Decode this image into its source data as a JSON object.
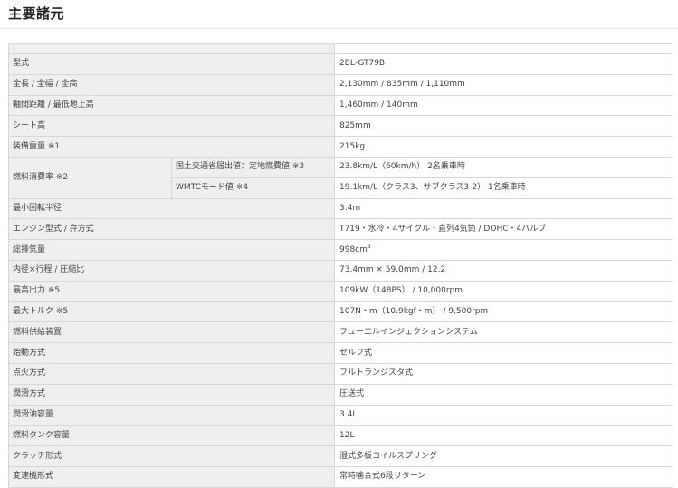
{
  "heading": "主要諸元",
  "rows": [
    {
      "label": "型式",
      "value": "2BL-GT79B"
    },
    {
      "label": "全長 / 全幅 / 全高",
      "value": "2,130mm / 835mm / 1,110mm"
    },
    {
      "label": "軸間距離 / 最低地上高",
      "value": "1,460mm / 140mm"
    },
    {
      "label": "シート高",
      "value": "825mm"
    },
    {
      "label": "装備重量 ※1",
      "value": "215kg"
    },
    {
      "label": "燃料消費率 ※2",
      "sub_rows": [
        {
          "label": "国土交通省届出値：定地燃費値 ※3",
          "value": "23.8km/L（60km/h） 2名乗車時"
        },
        {
          "label": "WMTCモード値 ※4",
          "value": "19.1km/L（クラス3、サブクラス3-2） 1名乗車時"
        }
      ]
    },
    {
      "label": "最小回転半径",
      "value": "3.4m"
    },
    {
      "label": "エンジン型式 / 弁方式",
      "value": "T719・水冷・4サイクル・直列4気筒 / DOHC・4バルブ"
    },
    {
      "label": "総排気量",
      "value": "998cm",
      "value_sup": "3"
    },
    {
      "label": "内径×行程 / 圧縮比",
      "value": "73.4mm × 59.0mm / 12.2"
    },
    {
      "label": "最高出力 ※5",
      "value": "109kW（148PS） / 10,000rpm"
    },
    {
      "label": "最大トルク ※5",
      "value": "107N・m（10.9kgf・m） / 9,500rpm"
    },
    {
      "label": "燃料供給装置",
      "value": "フューエルインジェクションシステム"
    },
    {
      "label": "始動方式",
      "value": "セルフ式"
    },
    {
      "label": "点火方式",
      "value": "フルトランジスタ式"
    },
    {
      "label": "潤滑方式",
      "value": "圧送式"
    },
    {
      "label": "潤滑油容量",
      "value": "3.4L"
    },
    {
      "label": "燃料タンク容量",
      "value": "12L"
    },
    {
      "label": "クラッチ形式",
      "value": "湿式多板コイルスプリング"
    },
    {
      "label": "変速機形式",
      "value": "常時噛合式6段リターン"
    }
  ]
}
